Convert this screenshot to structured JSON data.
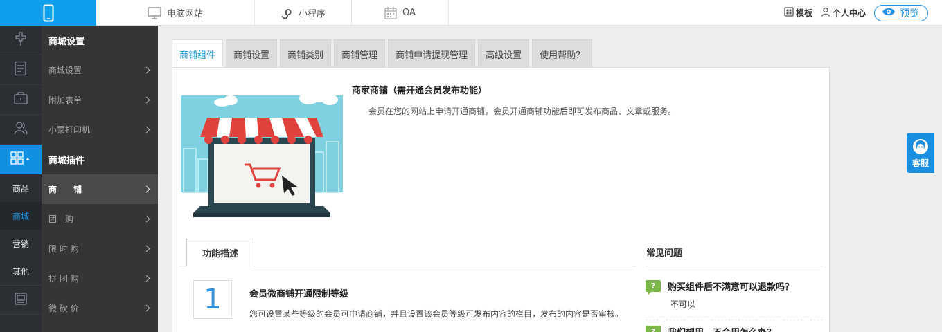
{
  "topbar": {
    "nav": [
      {
        "label": "电脑网站",
        "icon": "monitor-icon"
      },
      {
        "label": "小程序",
        "icon": "miniprogram-icon"
      },
      {
        "label": "OA",
        "icon": "calendar-icon"
      }
    ],
    "template_label": "模板",
    "user_center_label": "个人中心",
    "preview_label": "预览"
  },
  "rail": {
    "text_items": [
      "商品",
      "商城",
      "营销",
      "其他"
    ],
    "active_text": "商城"
  },
  "submenu": {
    "section1_title": "商城设置",
    "section1_items": [
      "商城设置",
      "附加表单",
      "小票打印机"
    ],
    "section2_title": "商城插件",
    "section2_items": [
      "商　　铺",
      "团　购",
      "限 时 购",
      "拼 团 购",
      "微 砍 价"
    ]
  },
  "tabs": [
    "商铺组件",
    "商铺设置",
    "商铺类别",
    "商铺管理",
    "商铺申请提现管理",
    "高级设置",
    "使用帮助？"
  ],
  "hero": {
    "title": "商家商铺（需开通会员发布功能）",
    "description": "会员在您的网站上申请开通商铺，会员开通商铺功能后即可发布商品、文章或服务。"
  },
  "function_tab": "功能描述",
  "feature": {
    "number": "1",
    "title": "会员微商铺开通限制等级",
    "description": "您可设置某些等级的会员可申请商铺，并且设置该会员等级可发布内容的栏目，发布的内容是否审核。"
  },
  "faq": {
    "title": "常见问题",
    "q_mark": "?",
    "items": [
      {
        "question": "购买组件后不满意可以退款吗？",
        "answer": "不可以"
      },
      {
        "question": "我们想用，不会用怎么办？",
        "answer": ""
      }
    ]
  },
  "service_label": "客服",
  "colors": {
    "brand_blue": "#0ea0ec",
    "sidebar_dark": "#2b2e33",
    "submenu": "#353535",
    "faq_green": "#7ab648"
  }
}
